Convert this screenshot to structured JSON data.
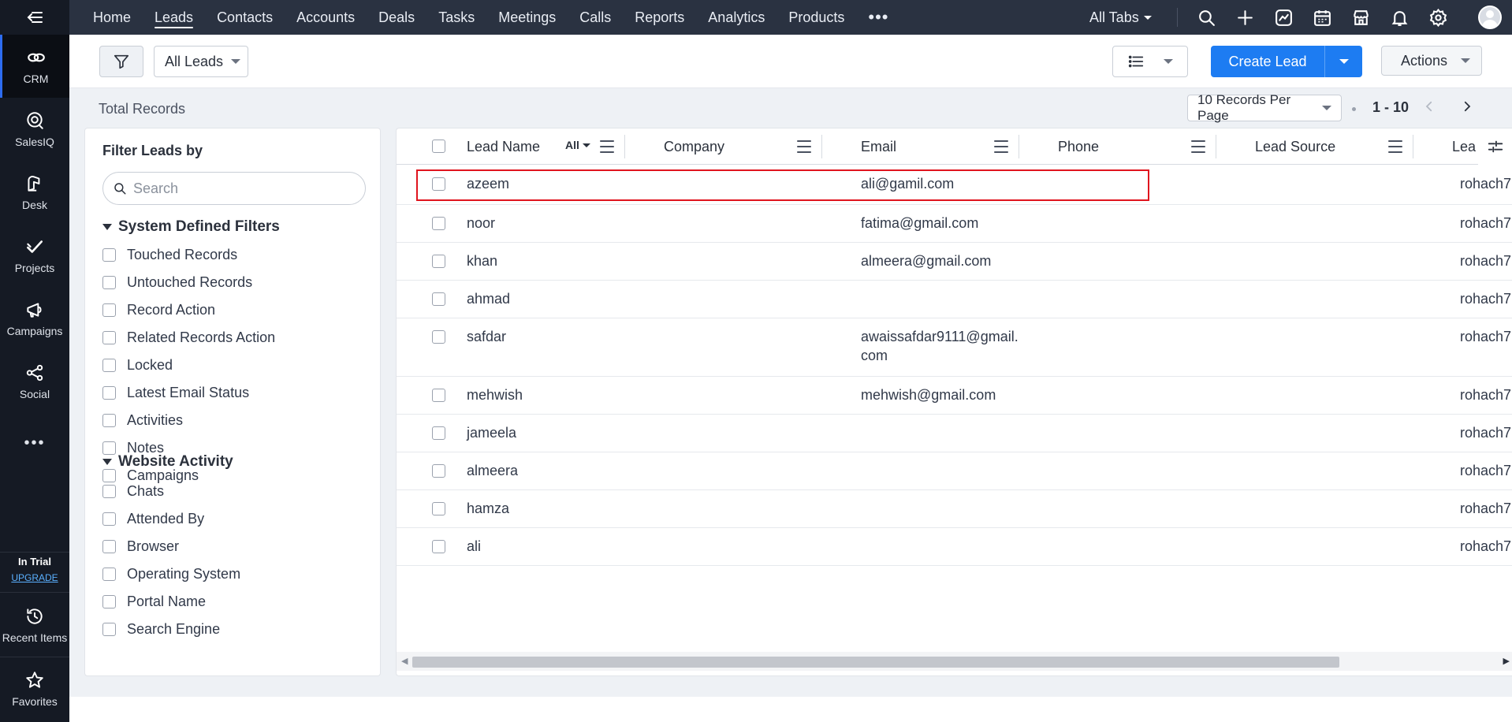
{
  "rail": {
    "active": "CRM",
    "items": [
      {
        "label": "CRM",
        "icon": "crm-icon"
      },
      {
        "label": "SalesIQ",
        "icon": "salesiq-icon"
      },
      {
        "label": "Desk",
        "icon": "desk-icon"
      },
      {
        "label": "Projects",
        "icon": "projects-icon"
      },
      {
        "label": "Campaigns",
        "icon": "campaigns-icon"
      },
      {
        "label": "Social",
        "icon": "social-icon"
      }
    ],
    "trial": {
      "label": "In Trial",
      "upgrade": "UPGRADE"
    },
    "bottom": [
      {
        "label": "Recent Items",
        "icon": "history-icon"
      },
      {
        "label": "Favorites",
        "icon": "star-icon"
      }
    ]
  },
  "nav": {
    "tabs": [
      "Home",
      "Leads",
      "Contacts",
      "Accounts",
      "Deals",
      "Tasks",
      "Meetings",
      "Calls",
      "Reports",
      "Analytics",
      "Products"
    ],
    "active": "Leads",
    "all_tabs": "All Tabs"
  },
  "toolbar": {
    "view": "All Leads",
    "create": "Create Lead",
    "actions": "Actions"
  },
  "records": {
    "total_label": "Total Records",
    "per_page": "10 Records Per Page",
    "range": "1 - 10"
  },
  "filters": {
    "title": "Filter Leads by",
    "search_placeholder": "Search",
    "system_title": "System Defined Filters",
    "system": [
      "Touched Records",
      "Untouched Records",
      "Record Action",
      "Related Records Action",
      "Locked",
      "Latest Email Status",
      "Activities",
      "Notes",
      "Campaigns"
    ],
    "website_title": "Website Activity",
    "website": [
      "Chats",
      "Attended By",
      "Browser",
      "Operating System",
      "Portal Name",
      "Search Engine"
    ]
  },
  "table": {
    "columns": {
      "lead_name": "Lead Name",
      "all": "All",
      "company": "Company",
      "email": "Email",
      "phone": "Phone",
      "lead_source": "Lead Source",
      "owner": "Lead Owner"
    },
    "rows": [
      {
        "name": "azeem",
        "company": "",
        "email": "ali@gamil.com",
        "phone": "",
        "source": "",
        "owner": "rohach7"
      },
      {
        "name": "noor",
        "company": "",
        "email": "fatima@gmail.com",
        "phone": "",
        "source": "",
        "owner": "rohach7"
      },
      {
        "name": "khan",
        "company": "",
        "email": "almeera@gmail.com",
        "phone": "",
        "source": "",
        "owner": "rohach7"
      },
      {
        "name": "ahmad",
        "company": "",
        "email": "",
        "phone": "",
        "source": "",
        "owner": "rohach7"
      },
      {
        "name": "safdar",
        "company": "",
        "email": "awaissafdar9111@gmail.",
        "email2": "com",
        "phone": "",
        "source": "",
        "owner": "rohach7"
      },
      {
        "name": "mehwish",
        "company": "",
        "email": "mehwish@gmail.com",
        "phone": "",
        "source": "",
        "owner": "rohach7"
      },
      {
        "name": "jameela",
        "company": "",
        "email": "",
        "phone": "",
        "source": "",
        "owner": "rohach7"
      },
      {
        "name": "almeera",
        "company": "",
        "email": "",
        "phone": "",
        "source": "",
        "owner": "rohach7"
      },
      {
        "name": "hamza",
        "company": "",
        "email": "",
        "phone": "",
        "source": "",
        "owner": "rohach7"
      },
      {
        "name": "ali",
        "company": "",
        "email": "",
        "phone": "",
        "source": "",
        "owner": "rohach7"
      }
    ]
  },
  "colors": {
    "accent": "#1d7cf2",
    "nav_bg": "#2a3241",
    "rail_bg": "#151a24",
    "highlight": "#e0141e"
  }
}
